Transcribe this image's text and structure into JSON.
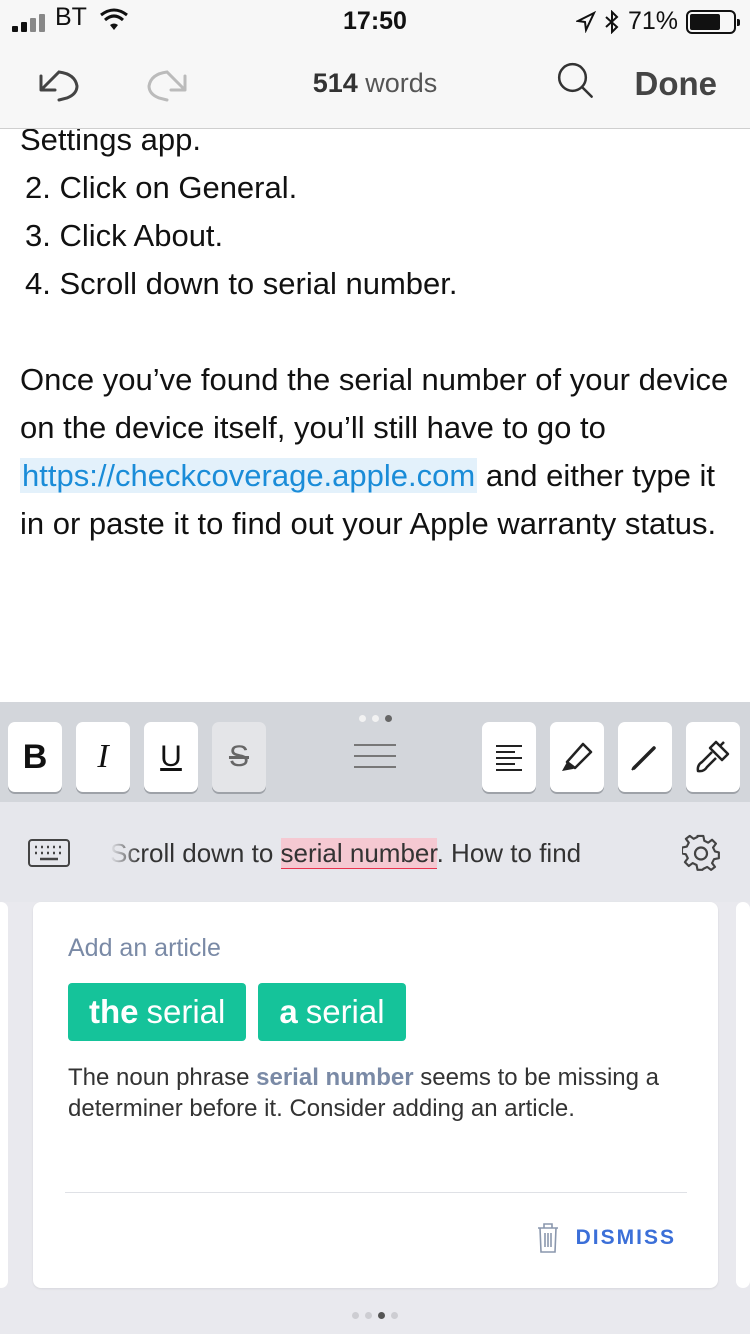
{
  "status_bar": {
    "carrier": "BT",
    "time": "17:50",
    "battery": "71%",
    "battery_level": 0.71,
    "icons": [
      "signal-icon",
      "wifi-icon",
      "location-icon",
      "bluetooth-icon",
      "battery-icon"
    ]
  },
  "nav": {
    "word_count": "514",
    "word_suffix": " words",
    "done_label": "Done",
    "icons": [
      "undo-icon",
      "redo-icon",
      "search-icon"
    ]
  },
  "document": {
    "partial_line": "Settings app.",
    "steps": [
      "2. Click on General.",
      "3. Click About.",
      "4. Scroll down to serial number."
    ],
    "para_before_link": "Once you’ve found the serial number of your device on the device itself, you’ll still have to go to ",
    "link_text": "https://checkcoverage.apple.com",
    "para_after_link": " and either type it in or paste it to find out your Apple warranty status."
  },
  "toolbar": {
    "bold": "B",
    "italic": "I",
    "underline": "U",
    "strikethrough": "S",
    "icons": [
      "align-left-icon",
      "highlighter-icon",
      "pen-icon",
      "paintbrush-icon"
    ]
  },
  "suggestion_bar": {
    "before": "Scroll down to ",
    "highlight": "serial number",
    "after": ".  How to find"
  },
  "card": {
    "title": "Add an article",
    "chips": [
      {
        "bold": "the",
        "rest": "serial"
      },
      {
        "bold": "a",
        "rest": "serial"
      }
    ],
    "desc_before": "The noun phrase ",
    "desc_keyword": "serial number",
    "desc_after": " seems to be missing a determiner before it. Consider adding an article.",
    "dismiss_label": "DISMISS"
  },
  "colors": {
    "accent_green": "#15c39a",
    "link_blue": "#1a8cd8",
    "error_red": "#e8334e",
    "dismiss_blue": "#3b6fd8"
  }
}
